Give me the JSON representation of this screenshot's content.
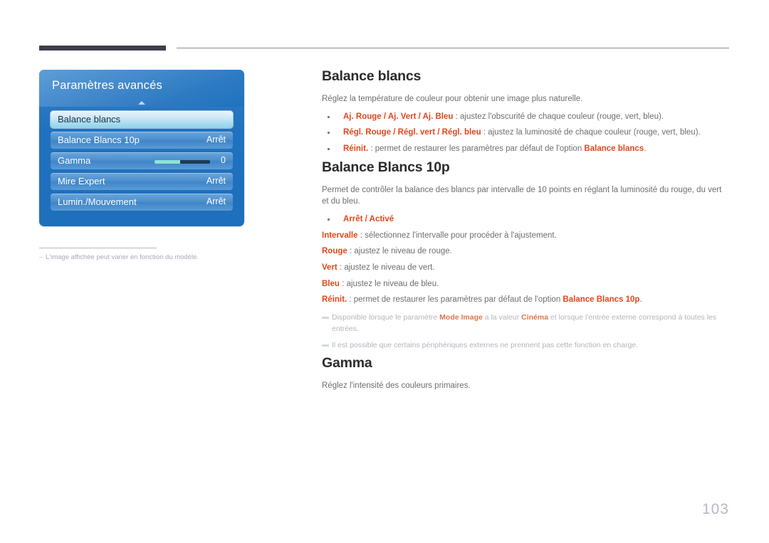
{
  "header": {
    "rule_left": "",
    "rule_right": ""
  },
  "osd": {
    "title": "Paramètres avancés",
    "caret_icon": "caret-up-icon",
    "rows": [
      {
        "label": "Balance blancs",
        "value": "",
        "selected": true,
        "type": "item"
      },
      {
        "label": "Balance Blancs 10p",
        "value": "Arrêt",
        "selected": false,
        "type": "item"
      },
      {
        "label": "Gamma",
        "value": "0",
        "selected": false,
        "type": "slider",
        "slider_percent": 46
      },
      {
        "label": "Mire Expert",
        "value": "Arrêt",
        "selected": false,
        "type": "item"
      },
      {
        "label": "Lumin./Mouvement",
        "value": "Arrêt",
        "selected": false,
        "type": "item"
      }
    ]
  },
  "left_footnote": {
    "dash": "–",
    "text": "L'image affichée peut varier en fonction du modèle."
  },
  "sections": {
    "balance_blancs": {
      "title": "Balance blancs",
      "intro": "Réglez la température de couleur pour obtenir une image plus naturelle.",
      "bullets": [
        {
          "accent": "Aj. Rouge / Aj. Vert / Aj. Bleu",
          "rest": " : ajustez l'obscurité de chaque couleur (rouge, vert, bleu)."
        },
        {
          "accent": "Régl. Rouge / Régl. vert / Régl. bleu",
          "rest": " : ajustez la luminosité de chaque couleur (rouge, vert, bleu)."
        },
        {
          "accent": "Réinit.",
          "rest": " : permet de restaurer les paramètres par défaut de l'option ",
          "accent2": "Balance blancs",
          "tail": "."
        }
      ]
    },
    "balance_blancs_10p": {
      "title": "Balance Blancs 10p",
      "intro": "Permet de contrôler la balance des blancs par intervalle de 10 points en réglant la luminosité du rouge, du vert et du bleu.",
      "bullets": [
        {
          "accent": "Arrêt / Activé",
          "rest": ""
        }
      ],
      "lines": [
        {
          "accent": "Intervalle",
          "rest": " : sélectionnez l'intervalle pour procéder à l'ajustement."
        },
        {
          "accent": "Rouge",
          "rest": " : ajustez le niveau de rouge."
        },
        {
          "accent": "Vert",
          "rest": " : ajustez le niveau de vert."
        },
        {
          "accent": "Bleu",
          "rest": " : ajustez le niveau de bleu."
        },
        {
          "accent": "Réinit.",
          "rest": " : permet de restaurer les paramètres par défaut de l'option ",
          "accent2": "Balance Blancs 10p",
          "tail": "."
        }
      ],
      "notes": [
        {
          "pre": "Disponible lorsque le paramètre ",
          "accent": "Mode Image",
          "mid": " a la valeur ",
          "accent2": "Cinéma",
          "post": " et lorsque l'entrée externe correspond à toutes les entrées."
        },
        {
          "pre": "Il est possible que certains périphériques externes ne prennent pas cette fonction en charge.",
          "accent": "",
          "mid": "",
          "accent2": "",
          "post": ""
        }
      ]
    },
    "gamma": {
      "title": "Gamma",
      "intro": "Réglez l'intensité des couleurs primaires."
    }
  },
  "page_number": "103",
  "colors": {
    "accent": "#e2471c",
    "osd_blue": "#1f72bf",
    "rule_dark": "#403e4c",
    "page_number": "#b7b7cb"
  }
}
